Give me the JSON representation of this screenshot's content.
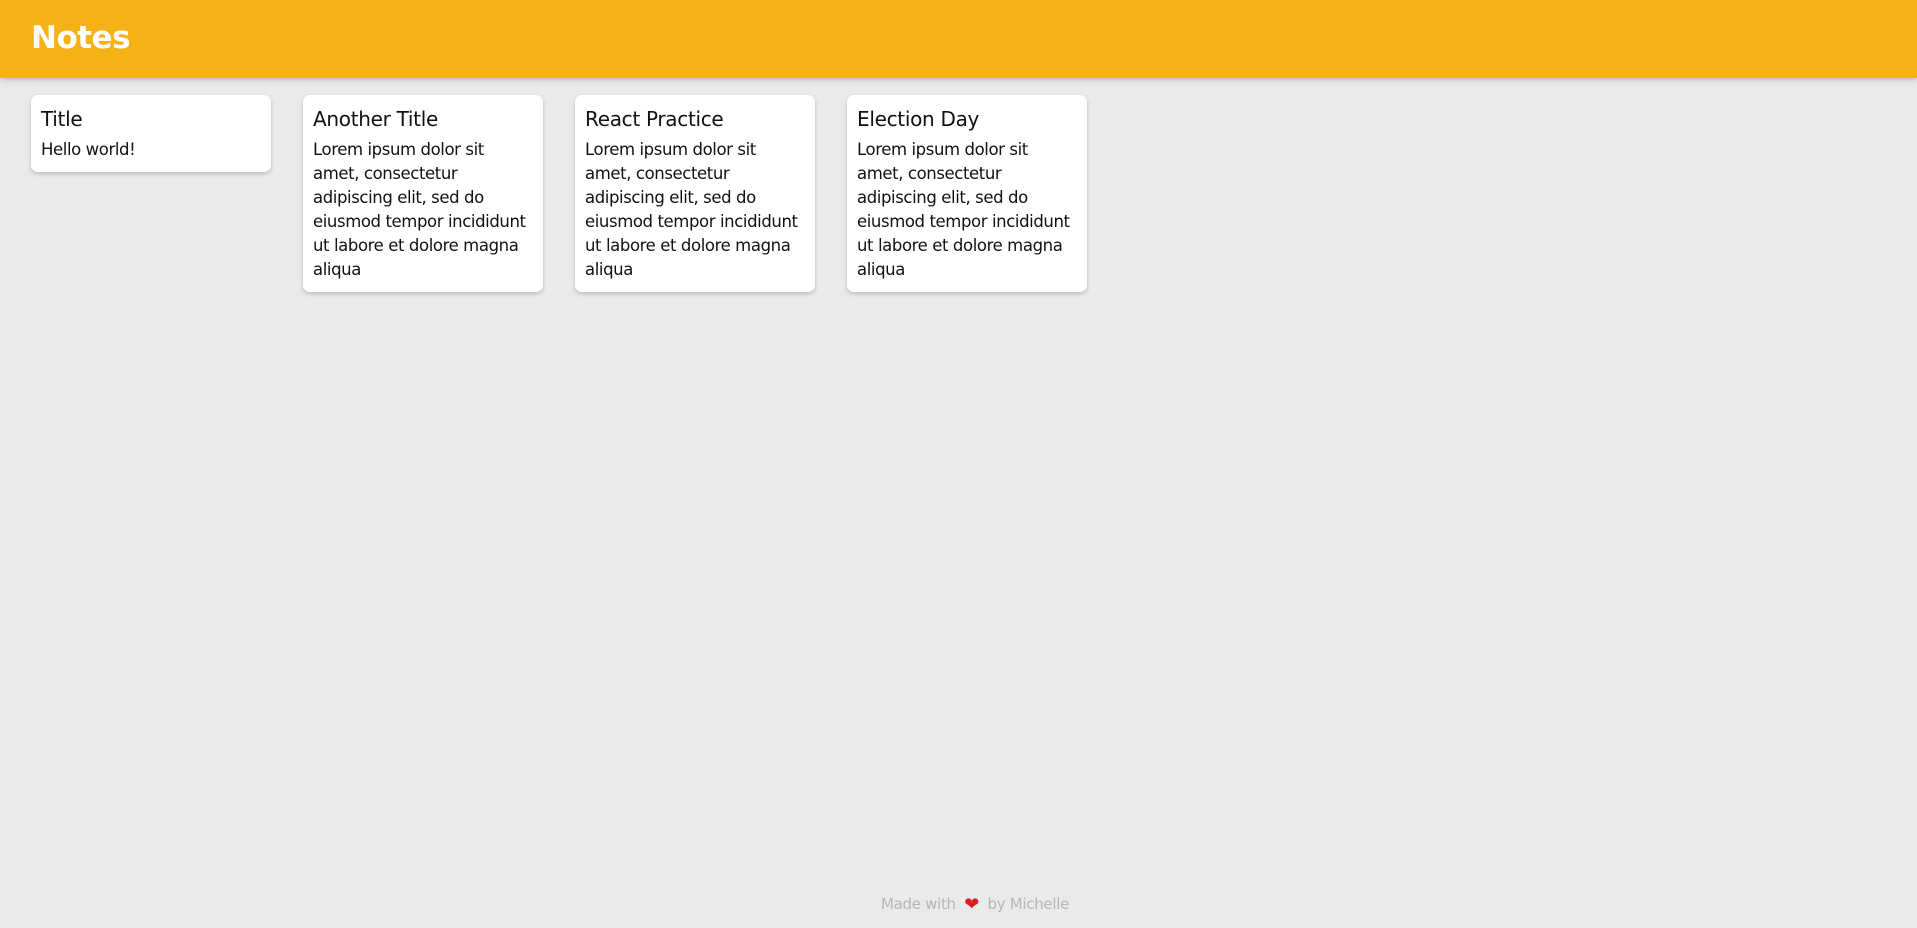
{
  "header": {
    "title": "Notes",
    "background_color": "#f4b217"
  },
  "notes": [
    {
      "title": "Title",
      "content": "Hello world!"
    },
    {
      "title": "Another Title",
      "content": "Lorem ipsum dolor sit amet, consectetur adipiscing elit, sed do eiusmod tempor incididunt ut labore et dolore magna aliqua"
    },
    {
      "title": "React Practice",
      "content": "Lorem ipsum dolor sit amet, consectetur adipiscing elit, sed do eiusmod tempor incididunt ut labore et dolore magna aliqua"
    },
    {
      "title": "Election Day",
      "content": "Lorem ipsum dolor sit amet, consectetur adipiscing elit, sed do eiusmod tempor incididunt ut labore et dolore magna aliqua"
    }
  ],
  "footer": {
    "prefix": "Made with",
    "icon": "heart-icon",
    "heart_glyph": "❤",
    "suffix": "by Michelle",
    "text_color": "#b5b5b5"
  },
  "page": {
    "background_color": "#eaeaea",
    "card_background": "#ffffff"
  }
}
